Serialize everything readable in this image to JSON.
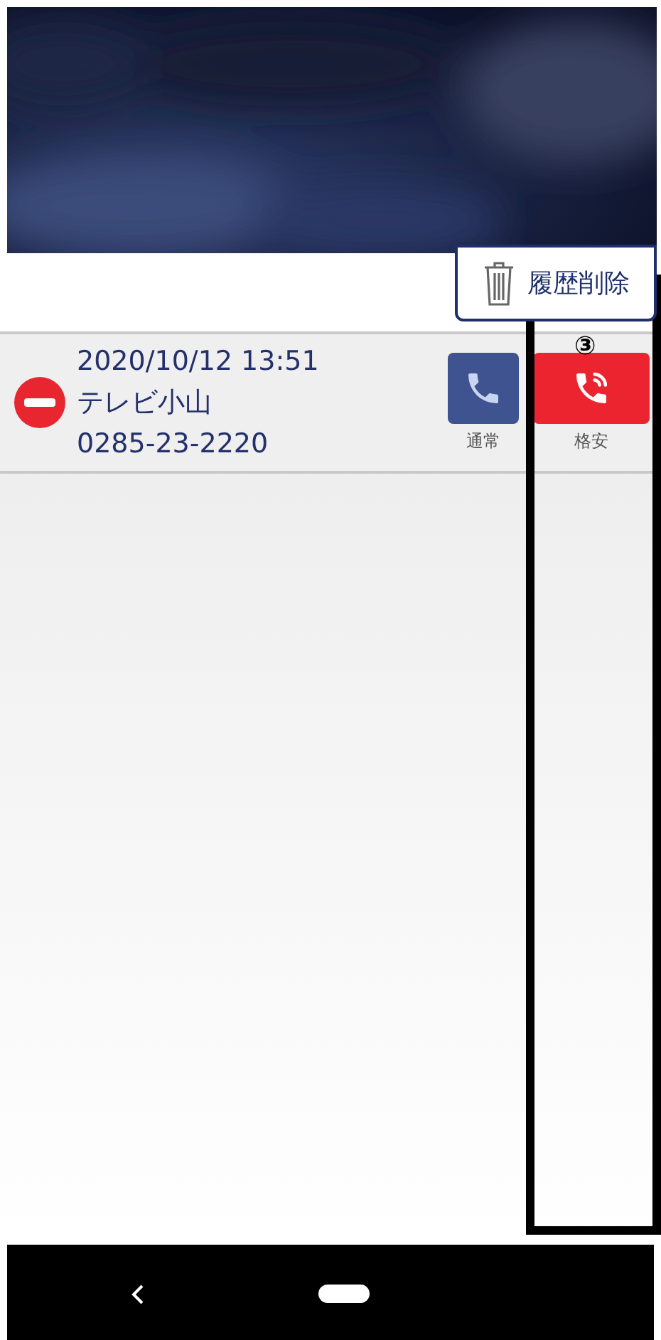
{
  "delete_button": {
    "label": "履歴削除"
  },
  "history": [
    {
      "datetime": "2020/10/12 13:51",
      "name": "テレビ小山",
      "number": "0285-23-2220",
      "normal_label": "通常",
      "cheap_label": "格安"
    }
  ],
  "annotation": {
    "label": "③"
  }
}
